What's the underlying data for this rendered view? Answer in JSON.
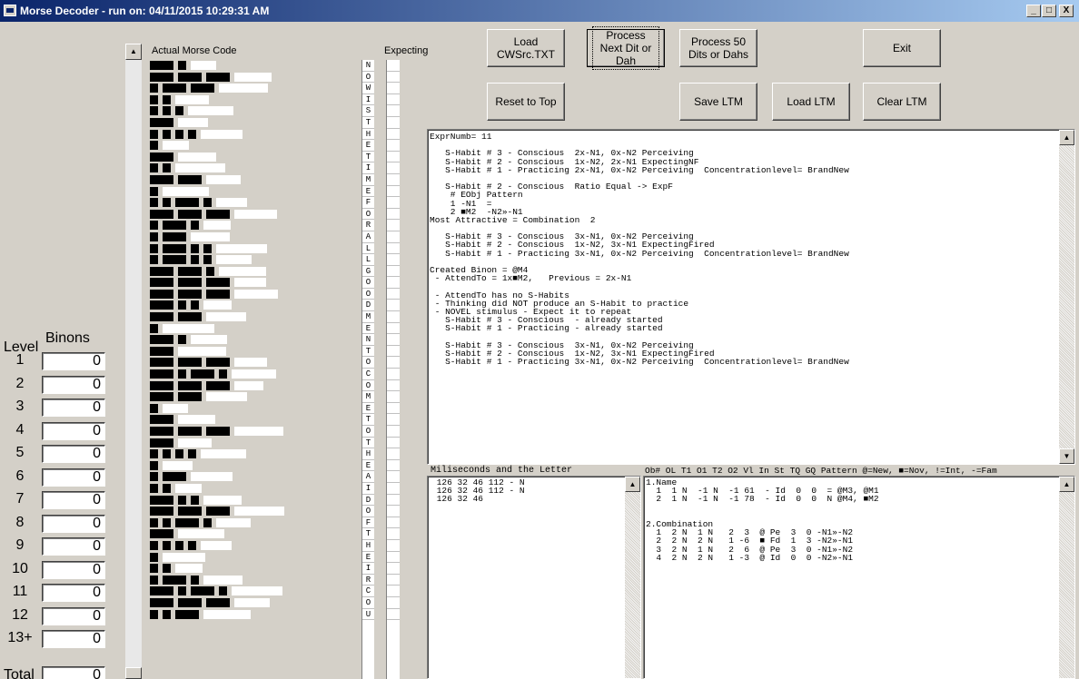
{
  "window": {
    "title": "Morse Decoder - run on: 04/11/2015  10:29:31 AM",
    "minimize": "_",
    "maximize": "□",
    "close": "X"
  },
  "levels": {
    "level_label": "Level",
    "binons_label": "Binons",
    "rows": [
      {
        "level": "1",
        "value": "0"
      },
      {
        "level": "2",
        "value": "0"
      },
      {
        "level": "3",
        "value": "0"
      },
      {
        "level": "4",
        "value": "0"
      },
      {
        "level": "5",
        "value": "0"
      },
      {
        "level": "6",
        "value": "0"
      },
      {
        "level": "7",
        "value": "0"
      },
      {
        "level": "8",
        "value": "0"
      },
      {
        "level": "9",
        "value": "0"
      },
      {
        "level": "10",
        "value": "0"
      },
      {
        "level": "11",
        "value": "0"
      },
      {
        "level": "12",
        "value": "0"
      },
      {
        "level": "13+",
        "value": "0"
      }
    ],
    "total_label": "Total",
    "total_value": "0"
  },
  "morse_header": "Actual Morse Code",
  "expecting_header": "Expecting",
  "letters": [
    "N",
    "O",
    "W",
    "I",
    "S",
    "T",
    "H",
    "E",
    "T",
    "I",
    "M",
    "E",
    "F",
    "O",
    "R",
    "A",
    "L",
    "L",
    "G",
    "O",
    "O",
    "D",
    "M",
    "E",
    "N",
    "T",
    "O",
    "C",
    "O",
    "M",
    "E",
    "T",
    "O",
    "T",
    "H",
    "E",
    "A",
    "I",
    "D",
    "O",
    "F",
    "T",
    "H",
    "E",
    "I",
    "R",
    "C",
    "O",
    "U"
  ],
  "morse_rows": [
    "-.",
    "---",
    ".--",
    "..",
    "...",
    "-",
    "....",
    ".",
    "-",
    "..",
    "--",
    ".",
    "..-.",
    "---",
    ".-.",
    ".-",
    ".-..",
    ".-..",
    "--.",
    "---",
    "---",
    "-..",
    "--",
    ".",
    "-.",
    "-",
    "---",
    "-.-.",
    "---",
    "--",
    ".",
    "-",
    "---",
    "-",
    "....",
    ".",
    ".-",
    "..",
    "-..",
    "---",
    "..-.",
    "-",
    "....",
    ".",
    "..",
    ".-.",
    "-.-.",
    "---",
    "..-"
  ],
  "buttons": {
    "load": "Load CWSrc.TXT",
    "process_next": "Process Next Dit or Dah",
    "process_50": "Process 50 Dits or Dahs",
    "exit": "Exit",
    "reset": "Reset to Top",
    "save_ltm": "Save LTM",
    "load_ltm": "Load LTM",
    "clear_ltm": "Clear LTM"
  },
  "log_lines": [
    "ExprNumb= 11",
    "",
    "   S-Habit # 3 - Conscious  2x-N1, 0x-N2 Perceiving",
    "   S-Habit # 2 - Conscious  1x-N2, 2x-N1 ExpectingNF",
    "   S-Habit # 1 - Practicing 2x-N1, 0x-N2 Perceiving  Concentrationlevel= BrandNew",
    "",
    "   S-Habit # 2 - Conscious  Ratio Equal -> ExpF",
    "    # EObj Pattern",
    "    1 -N1  =",
    "    2 ■M2  -N2»-N1",
    "Most Attractive = Combination  2",
    "",
    "   S-Habit # 3 - Conscious  3x-N1, 0x-N2 Perceiving",
    "   S-Habit # 2 - Conscious  1x-N2, 3x-N1 ExpectingFired",
    "   S-Habit # 1 - Practicing 3x-N1, 0x-N2 Perceiving  Concentrationlevel= BrandNew",
    "",
    "Created Binon = @M4",
    " - AttendTo = 1x■M2,   Previous = 2x-N1",
    "",
    " - AttendTo has no S-Habits",
    " - Thinking did NOT produce an S-Habit to practice",
    " - NOVEL stimulus - Expect it to repeat",
    "   S-Habit # 3 - Conscious  - already started",
    "   S-Habit # 1 - Practicing - already started",
    "",
    "   S-Habit # 3 - Conscious  3x-N1, 0x-N2 Perceiving",
    "   S-Habit # 2 - Conscious  1x-N2, 3x-N1 ExpectingFired",
    "   S-Habit # 1 - Practicing 3x-N1, 0x-N2 Perceiving  Concentrationlevel= BrandNew"
  ],
  "ms_header": "Miliseconds and the Letter",
  "ms_lines": [
    " 126 32 46 112 - N",
    " 126 32 46 112 - N",
    " 126 32 46"
  ],
  "binon_header": "Ob# OL T1 O1 T2 O2 Vl In St TQ GQ Pattern   @=New, ■=Nov, !=Int, -=Fam",
  "binon_lines": [
    "1.Name",
    "  1  1 N  -1 N  -1 61  - Id  0  0  = @M3, @M1",
    "  2  1 N  -1 N  -1 78  - Id  0  0  N @M4, ■M2",
    "",
    "",
    "2.Combination",
    "  1  2 N  1 N   2  3  @ Pe  3  0 -N1»-N2",
    "  2  2 N  2 N   1 -6  ■ Fd  1  3 -N2»-N1",
    "  3  2 N  1 N   2  6  @ Pe  3  0 -N1»-N2",
    "  4  2 N  2 N   1 -3  @ Id  0  0 -N2»-N1"
  ]
}
